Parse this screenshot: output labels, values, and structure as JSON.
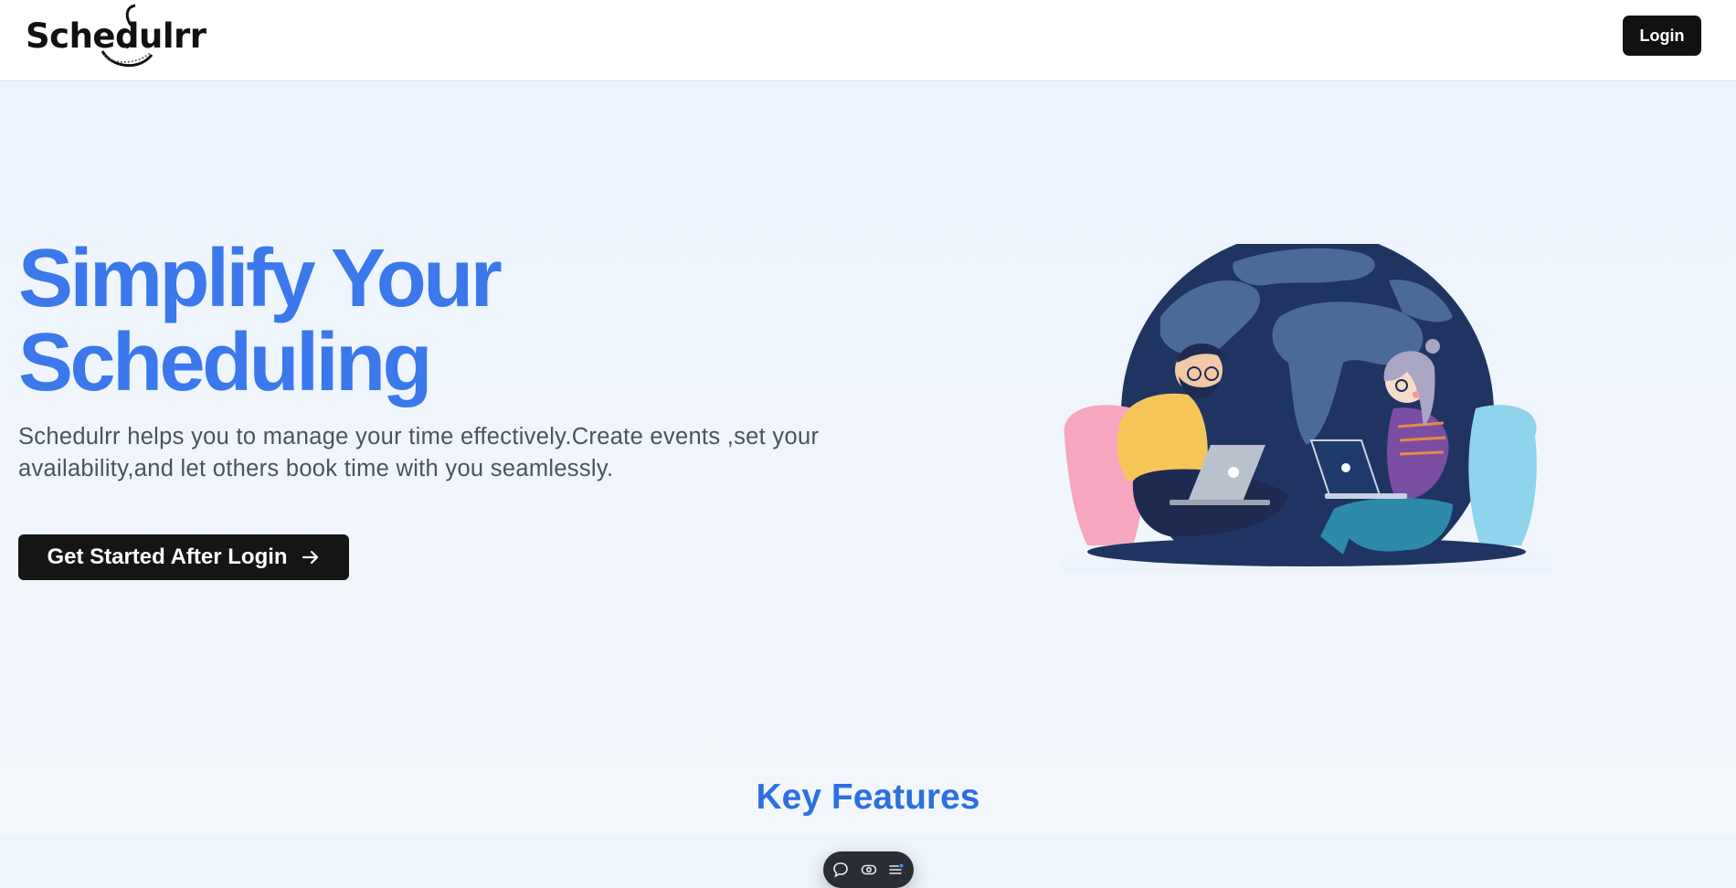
{
  "header": {
    "logo_text": "Schedulrr",
    "login_label": "Login"
  },
  "hero": {
    "title_line1": "Simplify Your",
    "title_line2": "Scheduling",
    "description": "Schedulrr helps you to manage your time effectively.Create events ,set your availability,and let others book time with you seamlessly.",
    "cta_label": "Get Started After Login",
    "cta_icon": "arrow-right-icon"
  },
  "features": {
    "title": "Key Features"
  },
  "floating_toolbar": {
    "icons": [
      "comment-icon",
      "eye-icon",
      "menu-list-icon"
    ]
  },
  "colors": {
    "accent_blue": "#3a78ec",
    "button_dark": "#111111",
    "page_bg": "#eff5fd"
  }
}
